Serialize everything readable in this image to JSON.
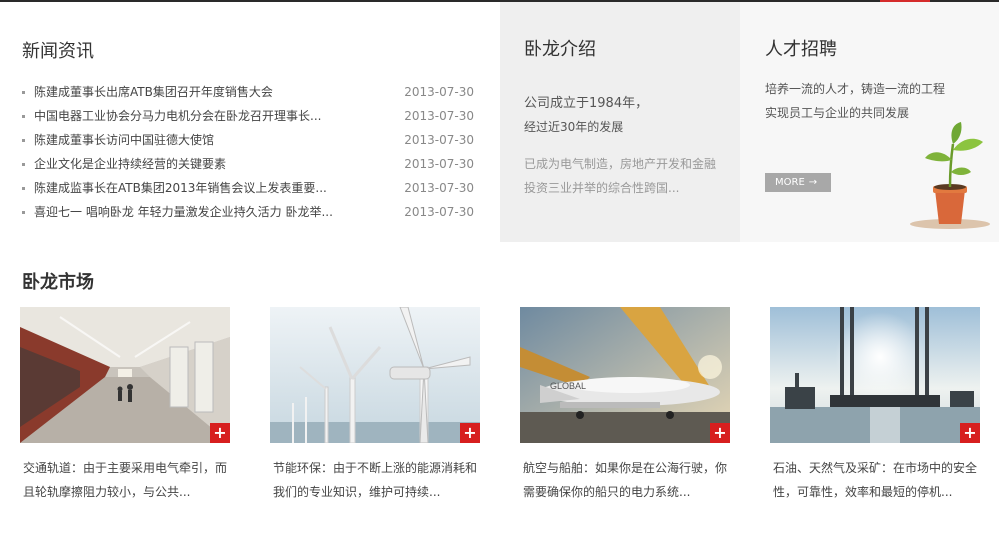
{
  "news": {
    "title": "新闻资讯",
    "items": [
      {
        "text": "陈建成董事长出席ATB集团召开年度销售大会",
        "date": "2013-07-30"
      },
      {
        "text": "中国电器工业协会分马力电机分会在卧龙召开理事长...",
        "date": "2013-07-30"
      },
      {
        "text": "陈建成董事长访问中国驻德大使馆",
        "date": "2013-07-30"
      },
      {
        "text": "企业文化是企业持续经营的关键要素",
        "date": "2013-07-30"
      },
      {
        "text": "陈建成监事长在ATB集团2013年销售会议上发表重要...",
        "date": "2013-07-30"
      },
      {
        "text": "喜迎七一 唱响卧龙 年轻力量激发企业持久活力 卧龙举...",
        "date": "2013-07-30"
      }
    ]
  },
  "about": {
    "title": "卧龙介绍",
    "lead_line1": "公司成立于1984年，",
    "lead_line2": "经过近30年的发展",
    "desc_line1": "已成为电气制造，房地产开发和金融",
    "desc_line2": "投资三业并举的综合性跨国..."
  },
  "jobs": {
    "title": "人才招聘",
    "line1": "培养一流的人才，铸造一流的工程",
    "line2": "实现员工与企业的共同发展",
    "more_label": "MORE",
    "more_arrow": "→",
    "icon": "plant-pot-icon"
  },
  "market": {
    "title": "卧龙市场",
    "plus_label": "+",
    "cards": [
      {
        "image": "subway-station-photo",
        "line1": "交通轨道：由于主要采用电气牵引，而",
        "line2": "且轮轨摩擦阻力较小，与公共..."
      },
      {
        "image": "wind-turbines-photo",
        "line1": "节能环保：由于不断上涨的能源消耗和",
        "line2": "我们的专业知识，维护可持续..."
      },
      {
        "image": "aircraft-photo",
        "line1": "航空与船舶：如果你是在公海行驶，你",
        "line2": "需要确保你的船只的电力系统..."
      },
      {
        "image": "oil-rig-photo",
        "line1": "石油、天然气及采矿：在市场中的安全",
        "line2": "性，可靠性，效率和最短的停机..."
      }
    ]
  },
  "colors": {
    "accent_red": "#d71f1f",
    "about_bg": "#efefef",
    "jobs_bg": "#f7f7f7",
    "more_bg": "#a8a8a8"
  }
}
